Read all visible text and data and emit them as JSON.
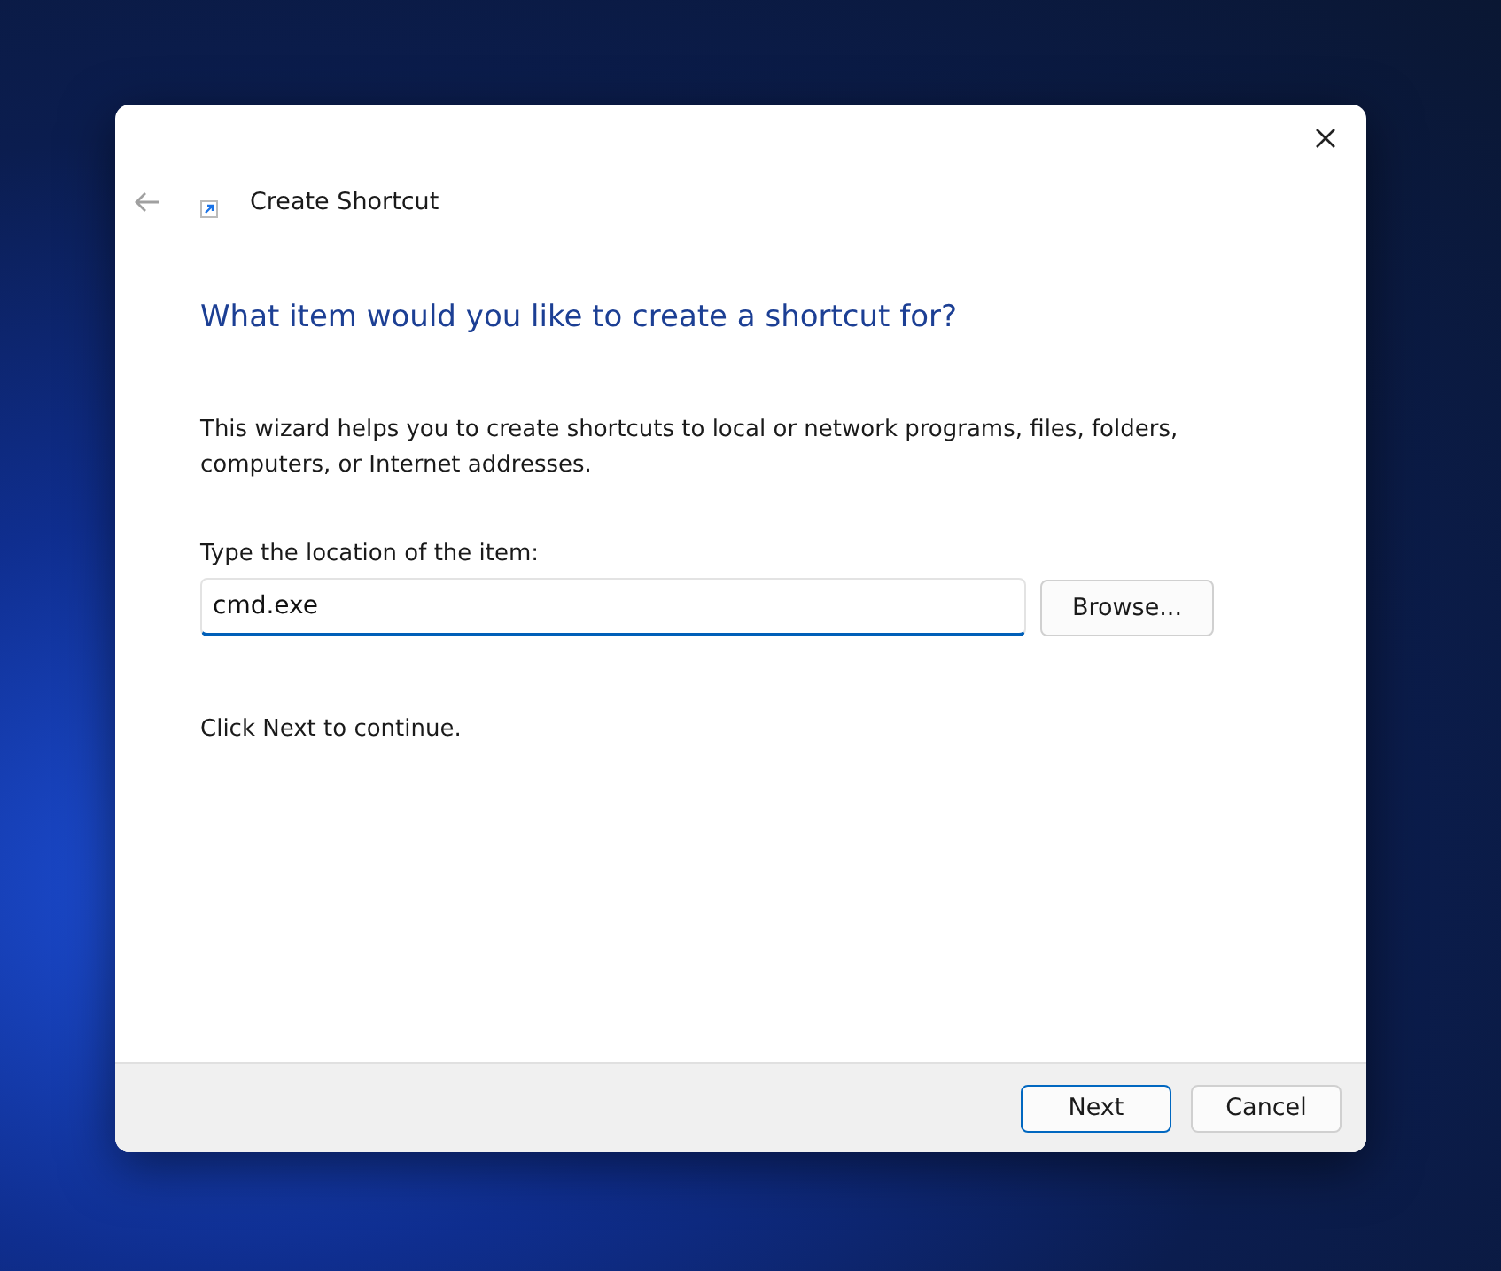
{
  "window": {
    "title": "Create Shortcut",
    "back_disabled": true
  },
  "heading": "What item would you like to create a shortcut for?",
  "description": "This wizard helps you to create shortcuts to local or network programs, files, folders, computers, or Internet addresses.",
  "location": {
    "label": "Type the location of the item:",
    "value": "cmd.exe",
    "focused": true,
    "browse": "Browse..."
  },
  "hint": "Click Next to continue.",
  "buttons": [
    {
      "label": "Next",
      "default": true
    },
    {
      "label": "Cancel",
      "default": false
    }
  ]
}
